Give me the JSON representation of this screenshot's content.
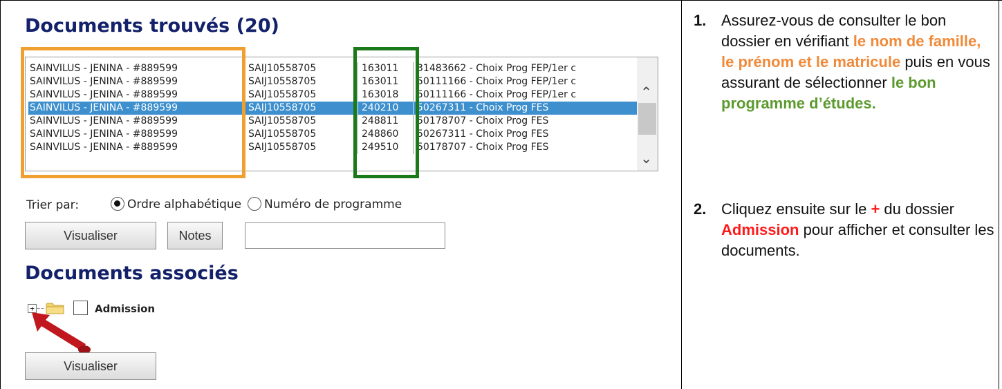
{
  "left": {
    "found_title": "Documents trouvés (20)",
    "rows": [
      {
        "name": "SAINVILUS - JENINA - #889599",
        "code": "SAIJ10558705",
        "prog": "163011",
        "desc": "31483662 - Choix Prog FEP/1er c",
        "selected": false
      },
      {
        "name": "SAINVILUS - JENINA - #889599",
        "code": "SAIJ10558705",
        "prog": "163011",
        "desc": "50111166 - Choix Prog FEP/1er c",
        "selected": false
      },
      {
        "name": "SAINVILUS - JENINA - #889599",
        "code": "SAIJ10558705",
        "prog": "163018",
        "desc": "50111166 - Choix Prog FEP/1er c",
        "selected": false
      },
      {
        "name": "SAINVILUS - JENINA - #889599",
        "code": "SAIJ10558705",
        "prog": "240210",
        "desc": "50267311 - Choix Prog FES",
        "selected": true
      },
      {
        "name": "SAINVILUS - JENINA - #889599",
        "code": "SAIJ10558705",
        "prog": "248811",
        "desc": "50178707 - Choix Prog FES",
        "selected": false
      },
      {
        "name": "SAINVILUS - JENINA - #889599",
        "code": "SAIJ10558705",
        "prog": "248860",
        "desc": "50267311 - Choix Prog FES",
        "selected": false
      },
      {
        "name": "SAINVILUS - JENINA - #889599",
        "code": "SAIJ10558705",
        "prog": "249510",
        "desc": "50178707 - Choix Prog FES",
        "selected": false
      }
    ],
    "sort_label": "Trier par:",
    "sort_alpha": "Ordre alphabétique",
    "sort_num": "Numéro de programme",
    "sort_selected": "alpha",
    "visualiser_label": "Visualiser",
    "notes_label": "Notes",
    "notes_value": "",
    "assoc_title": "Documents associés",
    "tree_plus": "+",
    "tree_item": "Admission",
    "visualiser2_label": "Visualiser",
    "icons": {
      "scroll_up": "chevron-up-icon",
      "scroll_down": "chevron-down-icon",
      "folder": "folder-icon",
      "arrow": "red-arrow-icon"
    },
    "colors": {
      "heading": "#13216a",
      "selected_row": "#3d8fce",
      "highlight_name": "#f0a030",
      "highlight_prog": "#1a7a1a",
      "arrow": "#c0181e"
    }
  },
  "right": {
    "step1": {
      "num": "1.",
      "t1": "Assurez-vous de consulter le bon dossier en vérifiant ",
      "t2": "le nom de famille, le prénom et le matricule",
      "t3": " puis en vous assurant de sélectionner ",
      "t4": "le bon programme d’études."
    },
    "step2": {
      "num": "2.",
      "t1": "Cliquez ensuite sur le ",
      "t2": "+",
      "t3": " du dossier ",
      "t4": "Admission",
      "t5": " pour afficher et consulter les documents."
    },
    "colors": {
      "orange": "#f08a3a",
      "green": "#5c9a2e",
      "red": "#ff1a1a"
    }
  }
}
